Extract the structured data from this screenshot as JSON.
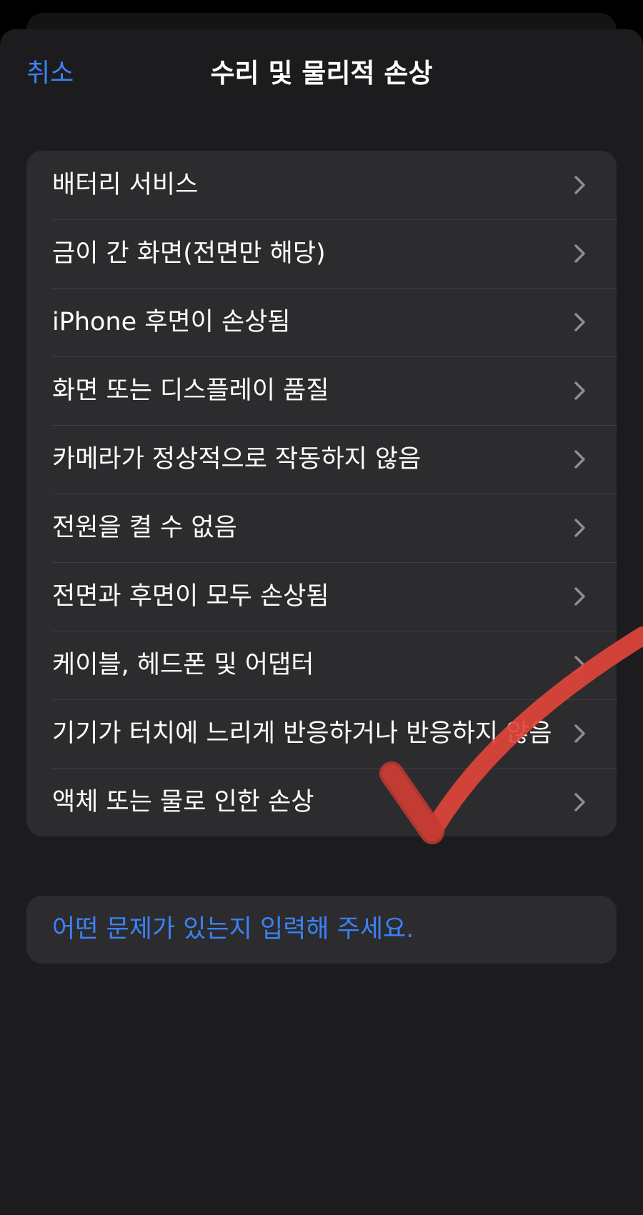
{
  "nav": {
    "cancel_label": "취소",
    "title": "수리 및 물리적 손상"
  },
  "menu": {
    "items": [
      {
        "label": "배터리 서비스"
      },
      {
        "label": "금이 간 화면(전면만 해당)"
      },
      {
        "label": "iPhone 후면이 손상됨"
      },
      {
        "label": "화면 또는 디스플레이 품질"
      },
      {
        "label": "카메라가 정상적으로 작동하지 않음"
      },
      {
        "label": "전원을 켤 수 없음"
      },
      {
        "label": "전면과 후면이 모두 손상됨"
      },
      {
        "label": "케이블, 헤드폰 및 어댑터"
      },
      {
        "label": "기기가 터치에 느리게 반응하거나 반응하지 않음"
      },
      {
        "label": "액체 또는 물로 인한 손상"
      }
    ],
    "chevron_icon": "chevron-right-icon"
  },
  "input": {
    "placeholder": "어떤 문제가 있는지 입력해 주세요."
  },
  "annotation": {
    "icon": "checkmark-icon",
    "color": "#e0443a"
  },
  "colors": {
    "accent": "#3b82f6",
    "background": "#1c1c1e",
    "cell": "#2c2c2e",
    "separator": "#3d3d41",
    "chevron": "#8e8e93"
  }
}
